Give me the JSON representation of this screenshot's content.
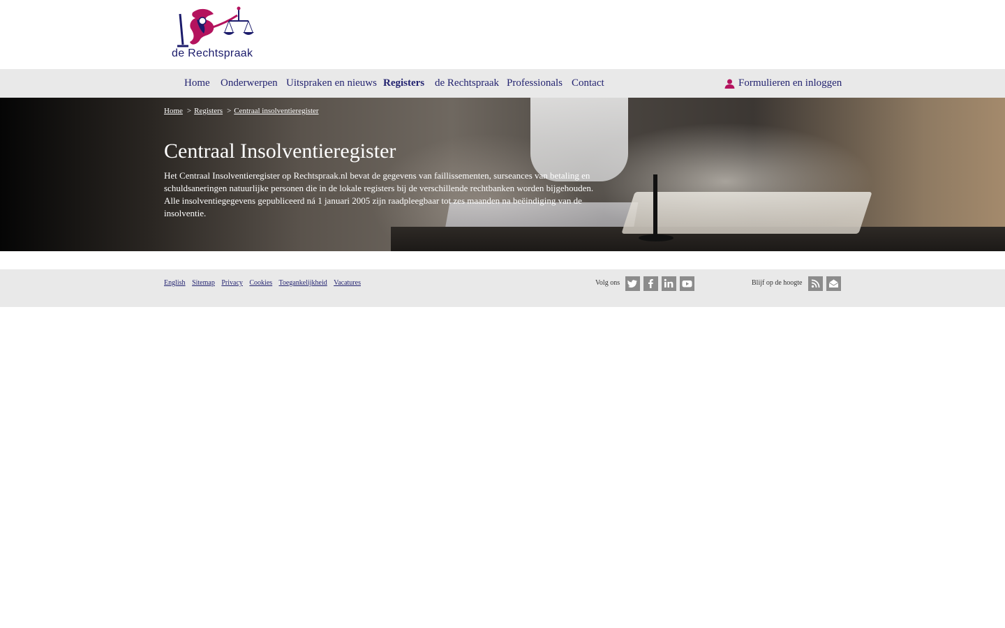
{
  "header": {
    "logo_text": "de Rechtspraak"
  },
  "nav": {
    "items": [
      {
        "label": "Home"
      },
      {
        "label": "Onderwerpen"
      },
      {
        "label": "Uitspraken en nieuws"
      },
      {
        "label": "Registers"
      },
      {
        "label": "de Rechtspraak"
      },
      {
        "label": "Professionals"
      },
      {
        "label": "Contact"
      }
    ],
    "active": "Registers",
    "login_label": "Formulieren en inloggen"
  },
  "breadcrumb": {
    "items": [
      "Home",
      "Registers",
      "Centraal insolventieregister"
    ],
    "separator": ">"
  },
  "hero": {
    "title": "Centraal Insolventieregister",
    "text": "Het Centraal Insolventieregister op Rechtspraak.nl bevat de gegevens van faillissementen, surseances van betaling en schuldsaneringen natuurlijke personen die in de lokale registers bij de verschillende rechtbanken worden bijgehouden. Alle insolventiegegevens gepubliceerd ná 1 januari 2005 zijn raadpleegbaar tot zes maanden na beëindiging van de insolventie."
  },
  "footer": {
    "links": [
      "English",
      "Sitemap",
      "Privacy",
      "Cookies",
      "Toegankelijkheid",
      "Vacatures"
    ],
    "follow_label": "Volg ons",
    "follow_icons": [
      "twitter-icon",
      "facebook-icon",
      "linkedin-icon",
      "youtube-icon"
    ],
    "stay_label": "Blijf op de hoogte",
    "stay_icons": [
      "rss-icon",
      "mail-icon"
    ]
  },
  "colors": {
    "brand_navy": "#232370",
    "brand_magenta": "#b4135e",
    "nav_bg": "#e9e9e9",
    "icon_grey": "#8c8c8c"
  }
}
